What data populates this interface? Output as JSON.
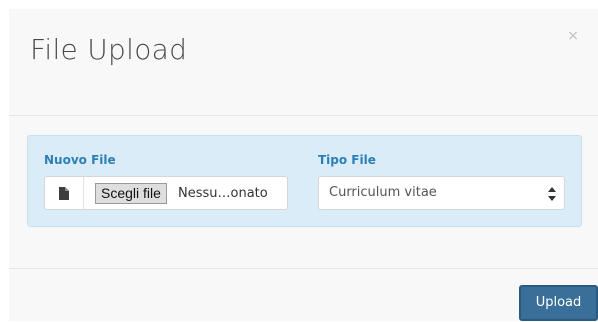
{
  "modal": {
    "title": "File Upload",
    "close_label": "×"
  },
  "form": {
    "file_field": {
      "label": "Nuovo File",
      "button_label": "Scegli file",
      "selected_file_text": "Nessu…onato",
      "icon": "file-icon"
    },
    "type_field": {
      "label": "Tipo File",
      "selected_value": "Curriculum vitae",
      "icon": "select-arrows-icon"
    }
  },
  "footer": {
    "upload_label": "Upload"
  },
  "colors": {
    "panel_bg": "#d9ecf7",
    "label_blue": "#2d7fb5",
    "upload_bg": "#3a6f99"
  }
}
